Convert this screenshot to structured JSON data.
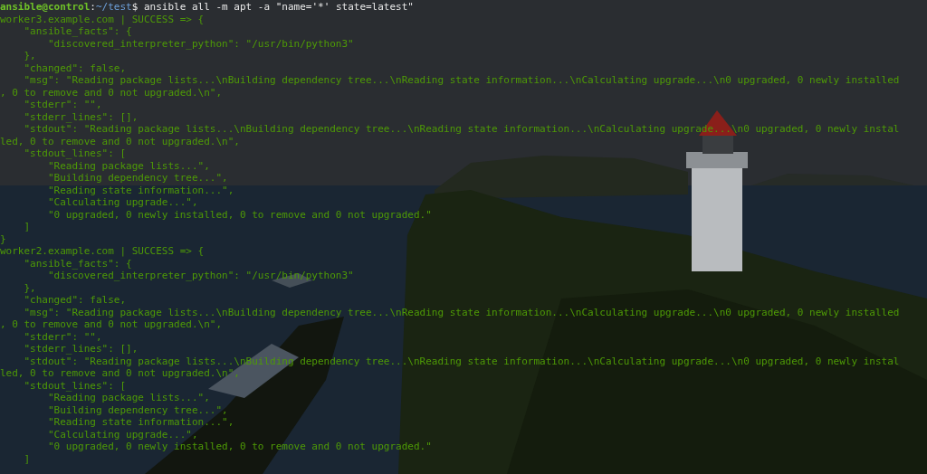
{
  "prompt": [
    {
      "kind": "user",
      "text": "ansible@control"
    },
    {
      "kind": "plain",
      "text": ":"
    },
    {
      "kind": "path",
      "text": "~/test"
    },
    {
      "kind": "plain",
      "text": "$ ansible all -m apt -a \"name='*' state=latest\""
    }
  ],
  "output_lines": [
    "worker3.example.com | SUCCESS => {",
    "    \"ansible_facts\": {",
    "        \"discovered_interpreter_python\": \"/usr/bin/python3\"",
    "    },",
    "    \"changed\": false,",
    "    \"msg\": \"Reading package lists...\\nBuilding dependency tree...\\nReading state information...\\nCalculating upgrade...\\n0 upgraded, 0 newly installed",
    ", 0 to remove and 0 not upgraded.\\n\",",
    "    \"stderr\": \"\",",
    "    \"stderr_lines\": [],",
    "    \"stdout\": \"Reading package lists...\\nBuilding dependency tree...\\nReading state information...\\nCalculating upgrade...\\n0 upgraded, 0 newly instal",
    "led, 0 to remove and 0 not upgraded.\\n\",",
    "    \"stdout_lines\": [",
    "        \"Reading package lists...\",",
    "        \"Building dependency tree...\",",
    "        \"Reading state information...\",",
    "        \"Calculating upgrade...\",",
    "        \"0 upgraded, 0 newly installed, 0 to remove and 0 not upgraded.\"",
    "    ]",
    "}",
    "worker2.example.com | SUCCESS => {",
    "    \"ansible_facts\": {",
    "        \"discovered_interpreter_python\": \"/usr/bin/python3\"",
    "    },",
    "    \"changed\": false,",
    "    \"msg\": \"Reading package lists...\\nBuilding dependency tree...\\nReading state information...\\nCalculating upgrade...\\n0 upgraded, 0 newly installed",
    ", 0 to remove and 0 not upgraded.\\n\",",
    "    \"stderr\": \"\",",
    "    \"stderr_lines\": [],",
    "    \"stdout\": \"Reading package lists...\\nBuilding dependency tree...\\nReading state information...\\nCalculating upgrade...\\n0 upgraded, 0 newly instal",
    "led, 0 to remove and 0 not upgraded.\\n\",",
    "    \"stdout_lines\": [",
    "        \"Reading package lists...\",",
    "        \"Building dependency tree...\",",
    "        \"Reading state information...\",",
    "        \"Calculating upgrade...\",",
    "        \"0 upgraded, 0 newly installed, 0 to remove and 0 not upgraded.\"",
    "    ]"
  ]
}
